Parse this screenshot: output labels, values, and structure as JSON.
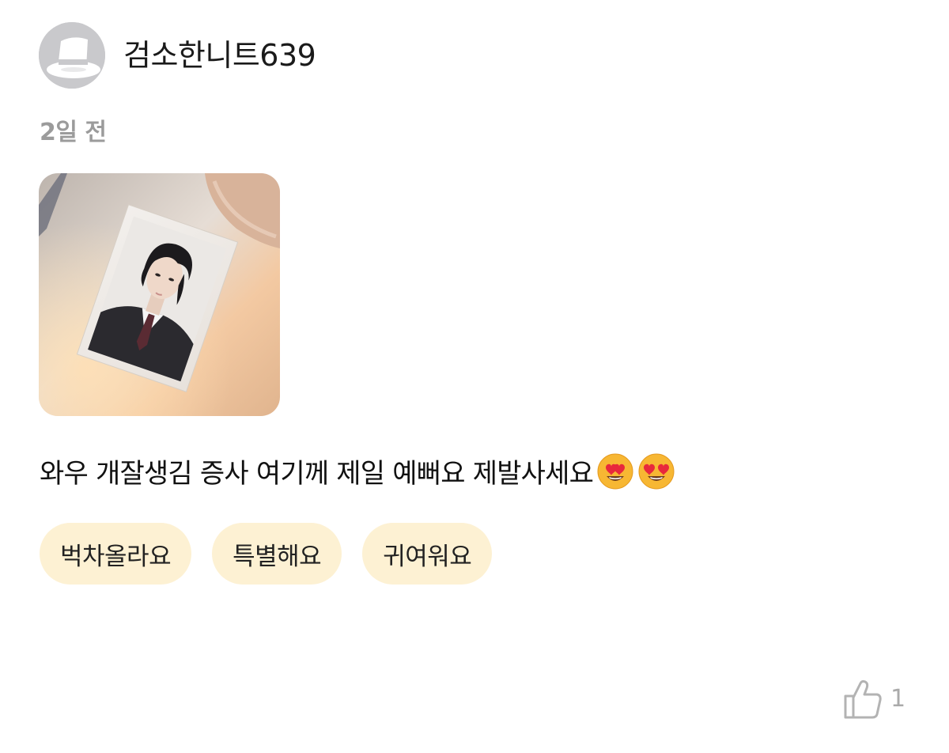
{
  "comment": {
    "author": "검소한니트639",
    "time_ago": "2일 전",
    "text": "와우 개잘생김 증사 여기께 제일 예뻐요 제발사세요",
    "emojis": [
      "heart-eyes-emoji",
      "heart-eyes-emoji"
    ],
    "tags": [
      {
        "label": "벅차올라요"
      },
      {
        "label": "특별해요"
      },
      {
        "label": "귀여워요"
      }
    ],
    "like_count": "1"
  },
  "colors": {
    "tag_background": "#fdf1d3",
    "timestamp": "#9b9b9b",
    "avatar_background": "#c9c9cc",
    "like_icon": "#aaaaaa"
  },
  "icons": {
    "avatar": "hat-avatar-icon",
    "like": "thumbs-up-icon"
  }
}
